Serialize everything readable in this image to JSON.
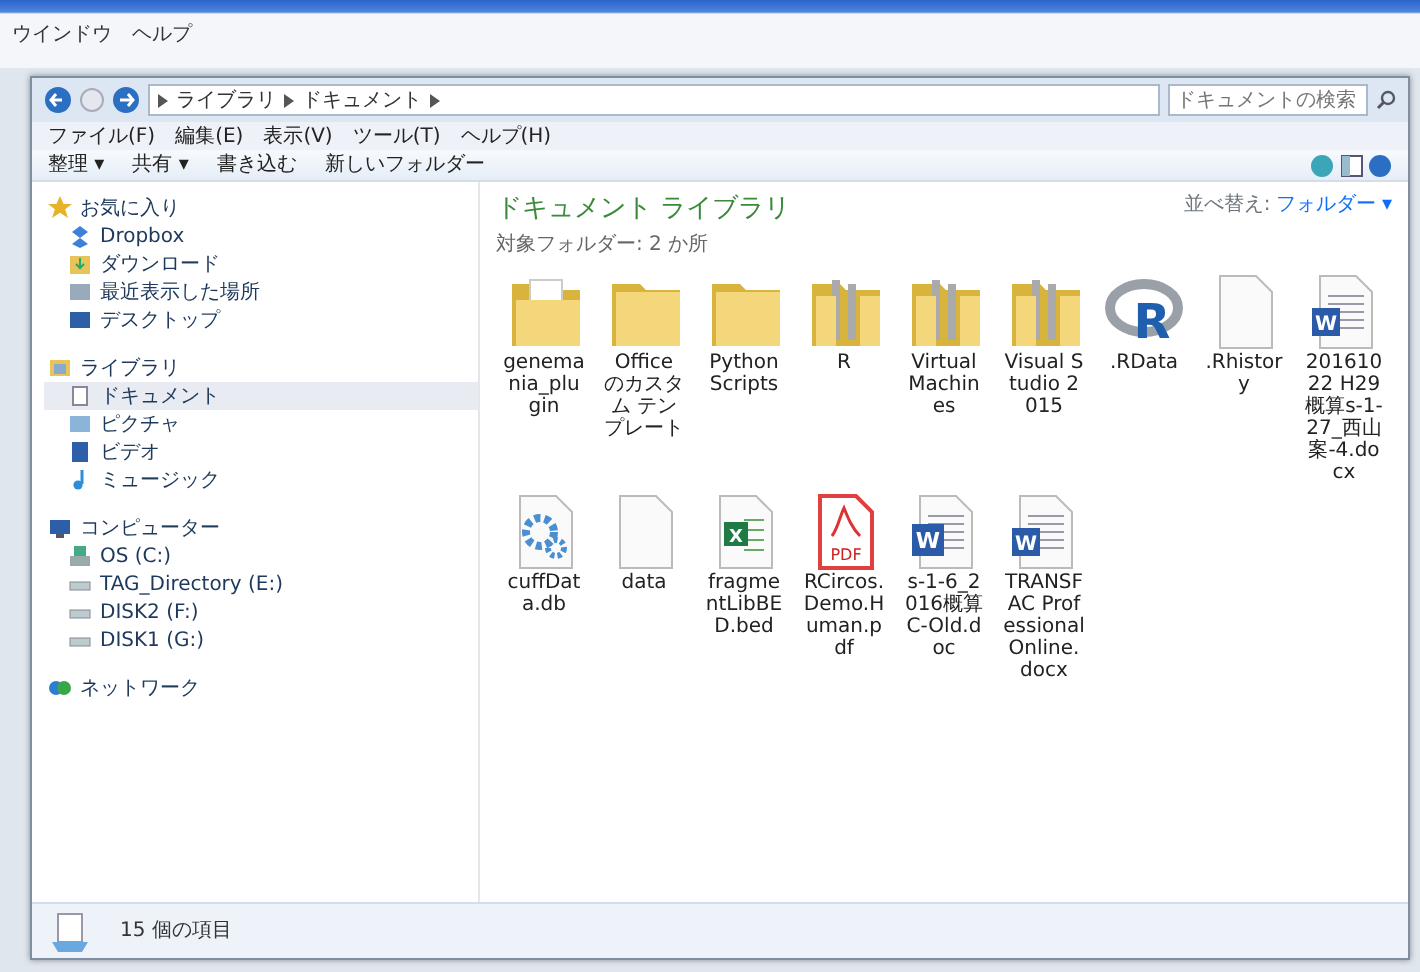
{
  "app_menu": [
    "ウインドウ",
    "ヘルプ"
  ],
  "address": {
    "path": [
      "ライブラリ",
      "ドキュメント"
    ],
    "search_placeholder": "ドキュメントの検索"
  },
  "menu": [
    "ファイル(F)",
    "編集(E)",
    "表示(V)",
    "ツール(T)",
    "ヘルプ(H)"
  ],
  "toolbar": [
    "整理 ▾",
    "共有 ▾",
    "書き込む",
    "新しいフォルダー"
  ],
  "sidebar": [
    {
      "label": "お気に入り",
      "kind": "star",
      "selected": false,
      "children": [
        {
          "label": "Dropbox",
          "kind": "dropbox",
          "selected": false
        },
        {
          "label": "ダウンロード",
          "kind": "download",
          "selected": false
        },
        {
          "label": "最近表示した場所",
          "kind": "recent",
          "selected": false
        },
        {
          "label": "デスクトップ",
          "kind": "desktop",
          "selected": false
        }
      ]
    },
    {
      "label": "ライブラリ",
      "kind": "library",
      "selected": false,
      "children": [
        {
          "label": "ドキュメント",
          "kind": "document",
          "selected": true
        },
        {
          "label": "ピクチャ",
          "kind": "picture",
          "selected": false
        },
        {
          "label": "ビデオ",
          "kind": "video",
          "selected": false
        },
        {
          "label": "ミュージック",
          "kind": "music",
          "selected": false
        }
      ]
    },
    {
      "label": "コンピューター",
      "kind": "computer",
      "selected": false,
      "children": [
        {
          "label": "OS (C:)",
          "kind": "os-drive",
          "selected": false
        },
        {
          "label": "TAG_Directory (E:)",
          "kind": "drive",
          "selected": false
        },
        {
          "label": "DISK2 (F:)",
          "kind": "drive",
          "selected": false
        },
        {
          "label": "DISK1 (G:)",
          "kind": "drive",
          "selected": false
        }
      ]
    },
    {
      "label": "ネットワーク",
      "kind": "network",
      "selected": false
    }
  ],
  "library": {
    "title": "ドキュメント ライブラリ",
    "subtitle": "対象フォルダー: 2 か所",
    "sort_label": "並べ替え:",
    "sort_value": "フォルダー ▾"
  },
  "files": [
    {
      "name": "genemania_plugin",
      "kind": "folder-page"
    },
    {
      "name": "Office のカスタム テンプレート",
      "kind": "folder"
    },
    {
      "name": "Python Scripts",
      "kind": "folder"
    },
    {
      "name": "R",
      "kind": "folder-files"
    },
    {
      "name": "Virtual Machines",
      "kind": "folder-files"
    },
    {
      "name": "Visual Studio 2015",
      "kind": "folder-files"
    },
    {
      "name": ".RData",
      "kind": "r-logo",
      "icon_text": "R"
    },
    {
      "name": ".Rhistory",
      "kind": "blank"
    },
    {
      "name": "20161022 H29概算s-1-27_西山案-4.docx",
      "kind": "word",
      "icon_text": "W"
    },
    {
      "name": "cuffData.db",
      "kind": "gear"
    },
    {
      "name": "data",
      "kind": "blank"
    },
    {
      "name": "fragmentLibBED.bed",
      "kind": "excel",
      "icon_text": "X"
    },
    {
      "name": "RCircos.Demo.Human.pdf",
      "kind": "pdf",
      "icon_text": "PDF"
    },
    {
      "name": "s-1-6_2016概算C-Old.doc",
      "kind": "word-old",
      "icon_text": "W"
    },
    {
      "name": "TRANSFAC Professional Online.docx",
      "kind": "word",
      "icon_text": "W"
    }
  ],
  "status_bar": {
    "count": "15 個の項目"
  }
}
